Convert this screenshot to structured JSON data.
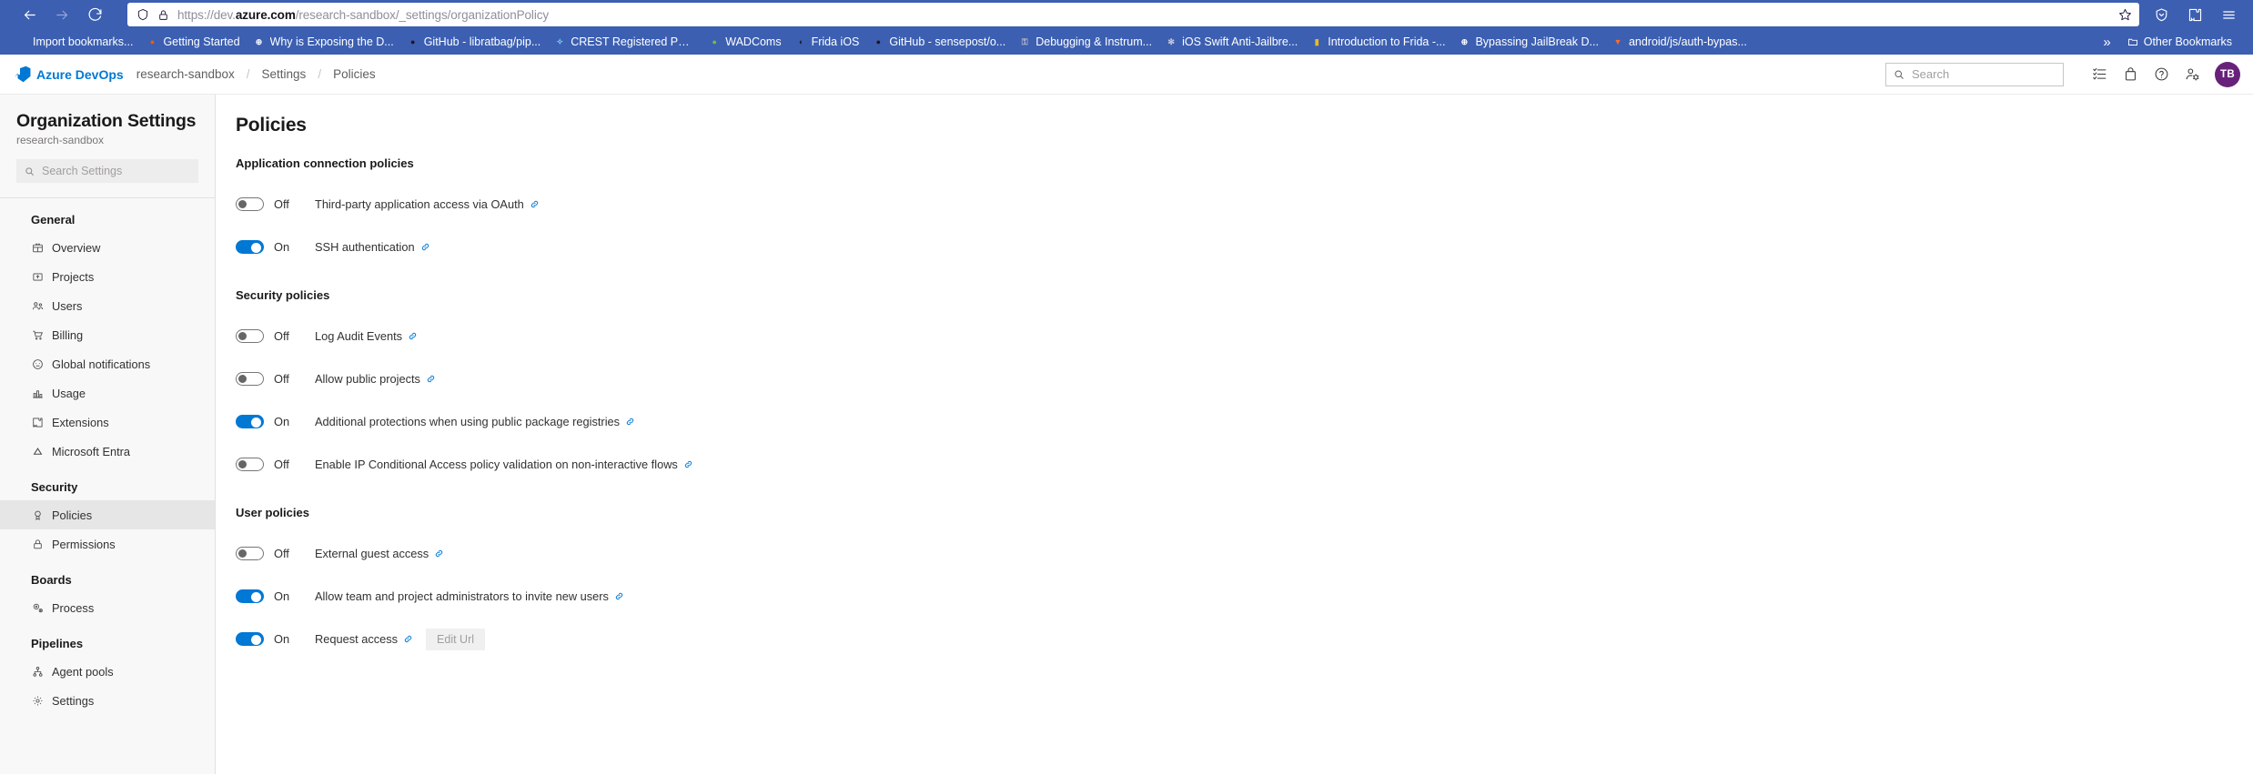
{
  "browser": {
    "back_label": "Back",
    "forward_label": "Forward",
    "reload_label": "Reload",
    "url_prefix": "https://dev.",
    "url_domain": "azure.com",
    "url_path": "/research-sandbox/_settings/organizationPolicy",
    "bookmark_star": "bookmark-star-icon",
    "right_icons": [
      "account-shield-icon",
      "extensions-puzzle-icon",
      "app-menu-icon"
    ],
    "bookmarks": [
      {
        "label": "Import bookmarks...",
        "icon": "import-icon",
        "color": "#3c5fb2",
        "glyph": "⮋"
      },
      {
        "label": "Getting Started",
        "icon": "firefox-icon",
        "color": "#e66000",
        "glyph": "●"
      },
      {
        "label": "Why is Exposing the D...",
        "icon": "globe-icon",
        "color": "#ffffff",
        "glyph": "⊕"
      },
      {
        "label": "GitHub - libratbag/pip...",
        "icon": "github-icon",
        "color": "#1b1a19",
        "glyph": "●"
      },
      {
        "label": "CREST Registered Pen...",
        "icon": "crest-icon",
        "color": "#7fd4f0",
        "glyph": "✧"
      },
      {
        "label": "WADComs",
        "icon": "wadcoms-icon",
        "color": "#78b943",
        "glyph": "●"
      },
      {
        "label": "Frida iOS",
        "icon": "frida-icon",
        "color": "#1b1a19",
        "glyph": "◖"
      },
      {
        "label": "GitHub - sensepost/o...",
        "icon": "github-icon",
        "color": "#1b1a19",
        "glyph": "●"
      },
      {
        "label": "Debugging & Instrum...",
        "icon": "key-icon",
        "color": "#b9b9c9",
        "glyph": "⚿"
      },
      {
        "label": "iOS Swift Anti-Jailbre...",
        "icon": "medium-icon",
        "color": "#c9c9d9",
        "glyph": "✻"
      },
      {
        "label": "Introduction to Frida -...",
        "icon": "ironman-icon",
        "color": "#e8b923",
        "glyph": "▮"
      },
      {
        "label": "Bypassing JailBreak D...",
        "icon": "globe-icon",
        "color": "#ffffff",
        "glyph": "⊕"
      },
      {
        "label": "android/js/auth-bypas...",
        "icon": "gitlab-icon",
        "color": "#fc6d26",
        "glyph": "▼"
      }
    ],
    "overflow_label": "»",
    "other_bookmarks_label": "Other Bookmarks"
  },
  "header": {
    "brand": "Azure DevOps",
    "breadcrumb": [
      "research-sandbox",
      "Settings",
      "Policies"
    ],
    "separator": "/",
    "search_placeholder": "Search",
    "icons": [
      "backlog-list-icon",
      "marketplace-bag-icon",
      "help-question-icon",
      "user-settings-icon"
    ],
    "avatar_initials": "TB",
    "avatar_color": "#68217a",
    "brand_color": "#0078d4"
  },
  "sidebar": {
    "title": "Organization Settings",
    "subtitle": "research-sandbox",
    "search_placeholder": "Search Settings",
    "groups": [
      {
        "title": "General",
        "items": [
          {
            "label": "Overview",
            "icon": "overview-grid-icon",
            "active": false
          },
          {
            "label": "Projects",
            "icon": "projects-box-icon",
            "active": false
          },
          {
            "label": "Users",
            "icon": "users-people-icon",
            "active": false
          },
          {
            "label": "Billing",
            "icon": "billing-cart-icon",
            "active": false
          },
          {
            "label": "Global notifications",
            "icon": "notifications-bell-icon",
            "active": false
          },
          {
            "label": "Usage",
            "icon": "usage-chart-icon",
            "active": false
          },
          {
            "label": "Extensions",
            "icon": "extensions-puzzle-icon",
            "active": false
          },
          {
            "label": "Microsoft Entra",
            "icon": "entra-diamond-icon",
            "active": false
          }
        ]
      },
      {
        "title": "Security",
        "items": [
          {
            "label": "Policies",
            "icon": "policies-shield-icon",
            "active": true
          },
          {
            "label": "Permissions",
            "icon": "permissions-lock-icon",
            "active": false
          }
        ]
      },
      {
        "title": "Boards",
        "items": [
          {
            "label": "Process",
            "icon": "process-gear-icon",
            "active": false
          }
        ]
      },
      {
        "title": "Pipelines",
        "items": [
          {
            "label": "Agent pools",
            "icon": "agent-pools-icon",
            "active": false
          },
          {
            "label": "Settings",
            "icon": "settings-gear-icon",
            "active": false
          }
        ]
      }
    ]
  },
  "main": {
    "page_title": "Policies",
    "toggle_on_label": "On",
    "toggle_off_label": "Off",
    "link_icon_name": "policy-link-icon",
    "accent_on_color": "#0078d4",
    "sections": [
      {
        "title": "Application connection policies",
        "policies": [
          {
            "label": "Third-party application access via OAuth",
            "state": "Off",
            "on": false
          },
          {
            "label": "SSH authentication",
            "state": "On",
            "on": true
          }
        ]
      },
      {
        "title": "Security policies",
        "policies": [
          {
            "label": "Log Audit Events",
            "state": "Off",
            "on": false
          },
          {
            "label": "Allow public projects",
            "state": "Off",
            "on": false
          },
          {
            "label": "Additional protections when using public package registries",
            "state": "On",
            "on": true
          },
          {
            "label": "Enable IP Conditional Access policy validation on non-interactive flows",
            "state": "Off",
            "on": false
          }
        ]
      },
      {
        "title": "User policies",
        "policies": [
          {
            "label": "External guest access",
            "state": "Off",
            "on": false
          },
          {
            "label": "Allow team and project administrators to invite new users",
            "state": "On",
            "on": true
          },
          {
            "label": "Request access",
            "state": "On",
            "on": true,
            "button": "Edit Url"
          }
        ]
      }
    ]
  }
}
